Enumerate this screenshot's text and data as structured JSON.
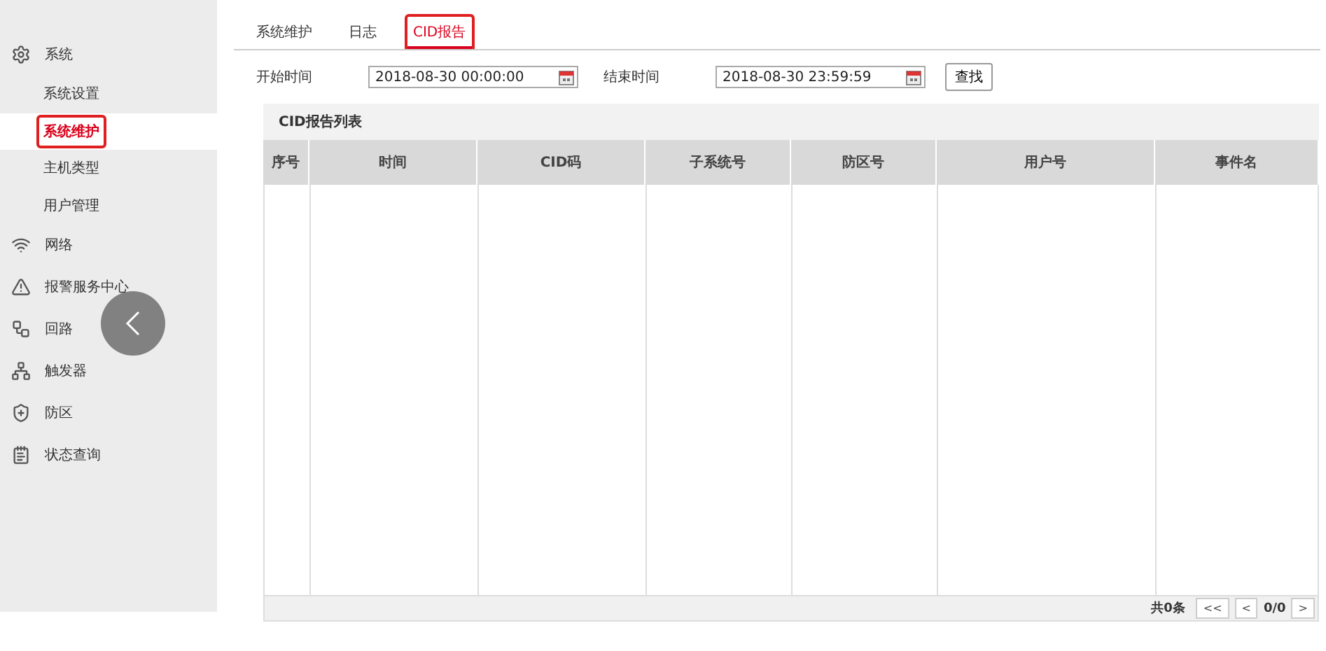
{
  "sidebar": {
    "items": [
      {
        "label": "系统",
        "children": [
          {
            "label": "系统设置",
            "selected": false
          },
          {
            "label": "系统维护",
            "selected": true
          },
          {
            "label": "主机类型",
            "selected": false
          },
          {
            "label": "用户管理",
            "selected": false
          }
        ]
      },
      {
        "label": "网络"
      },
      {
        "label": "报警服务中心"
      },
      {
        "label": "回路"
      },
      {
        "label": "触发器"
      },
      {
        "label": "防区"
      },
      {
        "label": "状态查询"
      }
    ]
  },
  "tabs": [
    {
      "label": "系统维护",
      "selected": false
    },
    {
      "label": "日志",
      "selected": false
    },
    {
      "label": "CID报告",
      "selected": true
    }
  ],
  "filters": {
    "start_label": "开始时间",
    "start_value": "2018-08-30 00:00:00",
    "end_label": "结束时间",
    "end_value": "2018-08-30 23:59:59",
    "search_button": "查找"
  },
  "table": {
    "title": "CID报告列表",
    "columns": [
      "序号",
      "时间",
      "CID码",
      "子系统号",
      "防区号",
      "用户号",
      "事件名"
    ]
  },
  "pagination": {
    "total": "共0条",
    "first": "<<",
    "prev": "<",
    "page": "0/0",
    "next": ">"
  }
}
